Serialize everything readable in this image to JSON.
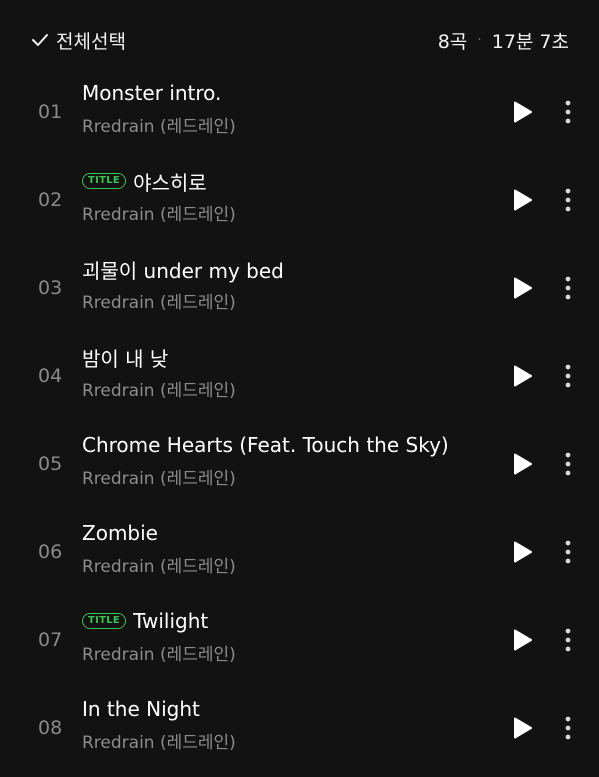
{
  "header": {
    "select_all_label": "전체선택",
    "track_count": "8곡",
    "separator": "·",
    "total_duration": "17분 7초"
  },
  "colors": {
    "background": "#121212",
    "badge": "#33c44a",
    "secondary_text": "#8c8c8c"
  },
  "tracks": [
    {
      "num": "01",
      "title": "Monster intro.",
      "artist": "Rredrain (레드레인)",
      "badge": ""
    },
    {
      "num": "02",
      "title": "야스히로",
      "artist": "Rredrain (레드레인)",
      "badge": "TITLE"
    },
    {
      "num": "03",
      "title": "괴물이 under my bed",
      "artist": "Rredrain (레드레인)",
      "badge": ""
    },
    {
      "num": "04",
      "title": "밤이 내 낮",
      "artist": "Rredrain (레드레인)",
      "badge": ""
    },
    {
      "num": "05",
      "title": "Chrome Hearts (Feat. Touch the Sky)",
      "artist": "Rredrain (레드레인)",
      "badge": ""
    },
    {
      "num": "06",
      "title": "Zombie",
      "artist": "Rredrain (레드레인)",
      "badge": ""
    },
    {
      "num": "07",
      "title": "Twilight",
      "artist": "Rredrain (레드레인)",
      "badge": "TITLE"
    },
    {
      "num": "08",
      "title": "In the Night",
      "artist": "Rredrain (레드레인)",
      "badge": ""
    }
  ],
  "icons": {
    "select_all": "check-icon",
    "play": "play-icon",
    "more": "more-vertical-icon"
  }
}
